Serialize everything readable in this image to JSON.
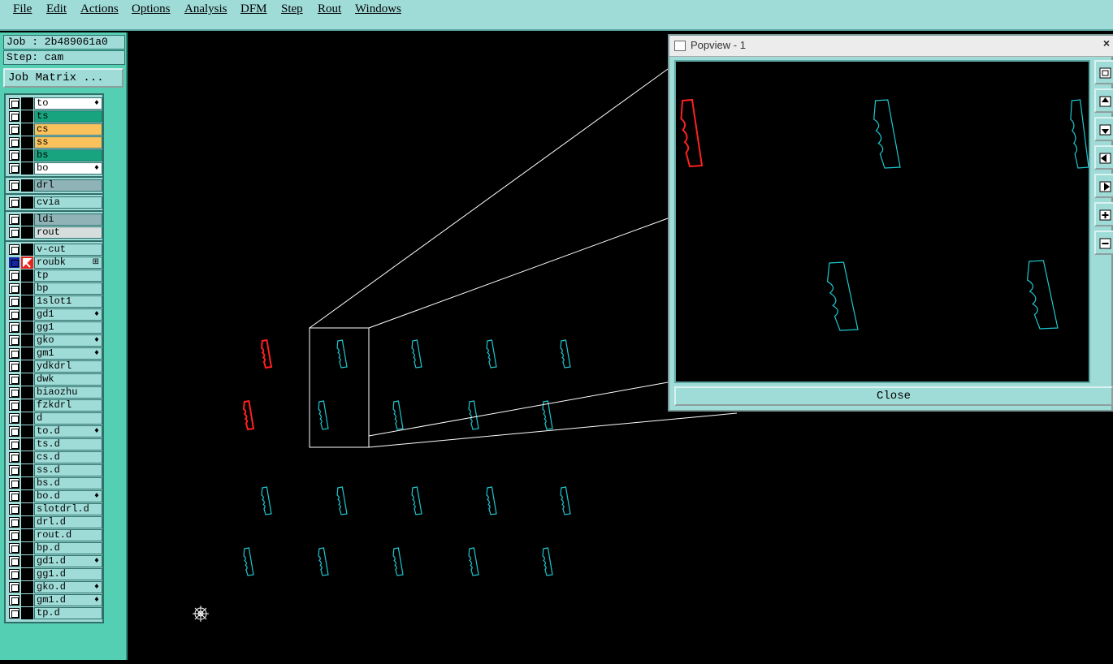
{
  "menu": {
    "items": [
      "File",
      "Edit",
      "Actions",
      "Options",
      "Analysis",
      "DFM",
      "Step",
      "Rout",
      "Windows"
    ]
  },
  "job": {
    "job_label": "Job : 2b489061a0",
    "step_label": "Step: cam",
    "job_matrix_label": "Job Matrix ..."
  },
  "layers": [
    {
      "name": "to",
      "color": "#ffffff",
      "mark": "fire-icon"
    },
    {
      "name": "ts",
      "color": "#17a47f",
      "mark": ""
    },
    {
      "name": "cs",
      "color": "#f9c25c",
      "mark": ""
    },
    {
      "name": "ss",
      "color": "#f9c25c",
      "mark": ""
    },
    {
      "name": "bs",
      "color": "#17a47f",
      "mark": ""
    },
    {
      "name": "bo",
      "color": "#ffffff",
      "mark": "fire-icon"
    },
    {
      "name": "drl",
      "color": "#8fb3b6",
      "mark": ""
    },
    {
      "name": "cvia",
      "color": "#9fdcd8",
      "mark": ""
    },
    {
      "name": "ldi",
      "color": "#8fb3b6",
      "mark": ""
    },
    {
      "name": "rout",
      "color": "#d6dedd",
      "mark": ""
    },
    {
      "name": "v-cut",
      "color": "#9fdcd8",
      "mark": ""
    },
    {
      "name": "roubk",
      "color": "#9fdcd8",
      "mark": "grid-icon",
      "active": true
    },
    {
      "name": "tp",
      "color": "#9fdcd8",
      "mark": ""
    },
    {
      "name": "bp",
      "color": "#9fdcd8",
      "mark": ""
    },
    {
      "name": "1slot1",
      "color": "#9fdcd8",
      "mark": ""
    },
    {
      "name": "gd1",
      "color": "#9fdcd8",
      "mark": "fire-icon"
    },
    {
      "name": "gg1",
      "color": "#9fdcd8",
      "mark": ""
    },
    {
      "name": "gko",
      "color": "#9fdcd8",
      "mark": "fire-icon"
    },
    {
      "name": "gm1",
      "color": "#9fdcd8",
      "mark": "fire-icon"
    },
    {
      "name": "ydkdrl",
      "color": "#9fdcd8",
      "mark": ""
    },
    {
      "name": "dwk",
      "color": "#9fdcd8",
      "mark": ""
    },
    {
      "name": "biaozhu",
      "color": "#9fdcd8",
      "mark": ""
    },
    {
      "name": "fzkdrl",
      "color": "#9fdcd8",
      "mark": ""
    },
    {
      "name": "d",
      "color": "#9fdcd8",
      "mark": ""
    },
    {
      "name": "to.d",
      "color": "#9fdcd8",
      "mark": "fire-icon"
    },
    {
      "name": "ts.d",
      "color": "#9fdcd8",
      "mark": ""
    },
    {
      "name": "cs.d",
      "color": "#9fdcd8",
      "mark": ""
    },
    {
      "name": "ss.d",
      "color": "#9fdcd8",
      "mark": ""
    },
    {
      "name": "bs.d",
      "color": "#9fdcd8",
      "mark": ""
    },
    {
      "name": "bo.d",
      "color": "#9fdcd8",
      "mark": "fire-icon"
    },
    {
      "name": "slotdrl.d",
      "color": "#9fdcd8",
      "mark": ""
    },
    {
      "name": "drl.d",
      "color": "#9fdcd8",
      "mark": ""
    },
    {
      "name": "rout.d",
      "color": "#9fdcd8",
      "mark": ""
    },
    {
      "name": "bp.d",
      "color": "#9fdcd8",
      "mark": ""
    },
    {
      "name": "gd1.d",
      "color": "#9fdcd8",
      "mark": "fire-icon"
    },
    {
      "name": "gg1.d",
      "color": "#9fdcd8",
      "mark": ""
    },
    {
      "name": "gko.d",
      "color": "#9fdcd8",
      "mark": "fire-icon"
    },
    {
      "name": "gm1.d",
      "color": "#9fdcd8",
      "mark": "fire-icon"
    },
    {
      "name": "tp.d",
      "color": "#9fdcd8",
      "mark": ""
    }
  ],
  "popview": {
    "title": "Popview - 1",
    "close_label": "Close",
    "close_x": "×",
    "tools": [
      "zoom-home-icon",
      "pan-up-icon",
      "pan-down-icon",
      "pan-left-icon",
      "pan-right-icon",
      "zoom-in-icon",
      "zoom-out-icon"
    ]
  },
  "colors": {
    "selected_feature": "#ff2020",
    "feature": "#1ec8d0",
    "outline": "#ffffff"
  },
  "canvas": {
    "snap_icon": "crosshair-icon"
  }
}
